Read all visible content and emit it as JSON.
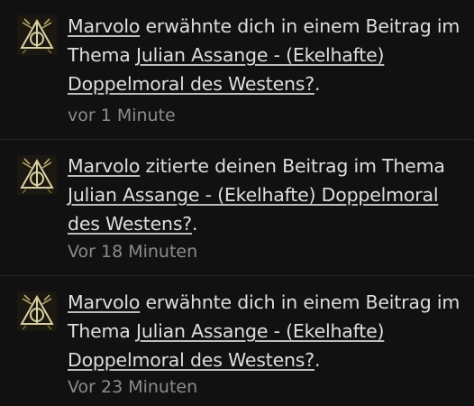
{
  "notifications": [
    {
      "user": "Marvolo",
      "action": " erwähnte dich in einem Beitrag im Thema ",
      "topic": "Julian Assange - (Ekelhafte) Doppelmoral des Westens?",
      "end": ".",
      "time": "vor 1 Minute",
      "avatar_icon": "deathly-hallows-avatar-icon"
    },
    {
      "user": "Marvolo",
      "action": " zitierte deinen Beitrag im Thema ",
      "topic": "Julian Assange - (Ekelhafte) Doppelmoral des Westens?",
      "end": ".",
      "time": "Vor 18 Minuten",
      "avatar_icon": "deathly-hallows-avatar-icon"
    },
    {
      "user": "Marvolo",
      "action": " erwähnte dich in einem Beitrag im Thema ",
      "topic": "Julian Assange - (Ekelhafte) Doppelmoral des Westens?",
      "end": ".",
      "time": "Vor 23 Minuten",
      "avatar_icon": "deathly-hallows-avatar-icon"
    }
  ]
}
